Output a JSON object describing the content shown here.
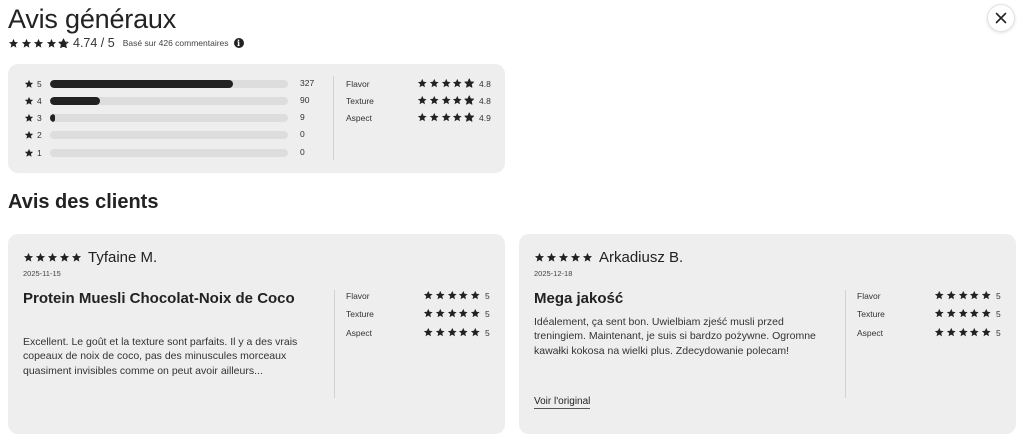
{
  "header": {
    "title": "Avis généraux",
    "overall_score": "4.74 / 5",
    "based_on": "Basé sur 426 commentaires",
    "info_glyph": "i",
    "overall_rating": 4.74
  },
  "icons": {
    "star": "star-icon",
    "close": "close-icon",
    "info": "info-icon"
  },
  "colors": {
    "star": "#222222",
    "panel_bg": "#eeeeee",
    "bar_track": "#dddddd",
    "bar_fill": "#222222"
  },
  "distribution": [
    {
      "label": "5",
      "count": "327",
      "fraction": 0.7676
    },
    {
      "label": "4",
      "count": "90",
      "fraction": 0.2113
    },
    {
      "label": "3",
      "count": "9",
      "fraction": 0.0211
    },
    {
      "label": "2",
      "count": "0",
      "fraction": 0
    },
    {
      "label": "1",
      "count": "0",
      "fraction": 0
    }
  ],
  "criteria": [
    {
      "label": "Flavor",
      "value": "4.8",
      "rating": 4.8
    },
    {
      "label": "Texture",
      "value": "4.8",
      "rating": 4.8
    },
    {
      "label": "Aspect",
      "value": "4.9",
      "rating": 4.9
    }
  ],
  "section_title": "Avis des clients",
  "reviews": [
    {
      "rating": 5,
      "name": "Tyfaine M.",
      "date": "2025-11-15",
      "title": "Protein Muesli Chocolat-Noix de Coco",
      "body": "Excellent. Le goût et la texture sont parfaits. Il y a des vrais copeaux de noix de coco, pas des minuscules morceaux quasiment invisibles comme on peut avoir ailleurs...",
      "see_original": "",
      "criteria": [
        {
          "label": "Flavor",
          "value": "5",
          "rating": 5
        },
        {
          "label": "Texture",
          "value": "5",
          "rating": 5
        },
        {
          "label": "Aspect",
          "value": "5",
          "rating": 5
        }
      ]
    },
    {
      "rating": 5,
      "name": "Arkadiusz B.",
      "date": "2025-12-18",
      "title": "Mega jakość",
      "body": "Idéalement, ça sent bon. Uwielbiam zjeść musli przed treningiem. Maintenant, je suis si bardzo pożywne. Ogromne kawałki kokosa na wielki plus. Zdecydowanie polecam!",
      "see_original": "Voir l'original",
      "criteria": [
        {
          "label": "Flavor",
          "value": "5",
          "rating": 5
        },
        {
          "label": "Texture",
          "value": "5",
          "rating": 5
        },
        {
          "label": "Aspect",
          "value": "5",
          "rating": 5
        }
      ]
    }
  ]
}
